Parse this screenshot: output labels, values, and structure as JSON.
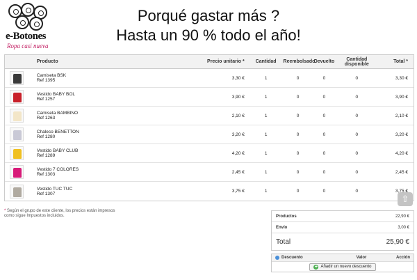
{
  "header": {
    "brand": "e-Botones",
    "tagline": "Ropa casi nueva",
    "promo_line1": "Porqué gastar más ?",
    "promo_line2": "Hasta un 90 % todo el año!"
  },
  "cart": {
    "columns": {
      "product": "Producto",
      "unit_price": "Precio unitario *",
      "quantity": "Cantidad",
      "refunded": "Reembolsado",
      "returned": "Devuelto",
      "available": "Cantidad disponible",
      "total": "Total *"
    },
    "rows": [
      {
        "name": "Camiseta BSK",
        "ref": "Ref 1395",
        "price": "3,30 €",
        "qty": "1",
        "refunded": "0",
        "returned": "0",
        "available": "0",
        "total": "3,30 €",
        "thumb_color": "#3a3a3a"
      },
      {
        "name": "Vestido BABY BOL",
        "ref": "Ref 1257",
        "price": "3,90 €",
        "qty": "1",
        "refunded": "0",
        "returned": "0",
        "available": "0",
        "total": "3,90 €",
        "thumb_color": "#c8202a"
      },
      {
        "name": "Camiseta BAMBINO",
        "ref": "Ref 1263",
        "price": "2,10 €",
        "qty": "1",
        "refunded": "0",
        "returned": "0",
        "available": "0",
        "total": "2,10 €",
        "thumb_color": "#f3e6c8"
      },
      {
        "name": "Chaleco BENETTON",
        "ref": "Ref 1280",
        "price": "3,20 €",
        "qty": "1",
        "refunded": "0",
        "returned": "0",
        "available": "0",
        "total": "3,20 €",
        "thumb_color": "#c9c9d6"
      },
      {
        "name": "Vestido BABY CLUB",
        "ref": "Ref 1289",
        "price": "4,20 €",
        "qty": "1",
        "refunded": "0",
        "returned": "0",
        "available": "0",
        "total": "4,20 €",
        "thumb_color": "#f0c020"
      },
      {
        "name": "Vestido 7 COLORES",
        "ref": "Ref 1303",
        "price": "2,45 €",
        "qty": "1",
        "refunded": "0",
        "returned": "0",
        "available": "0",
        "total": "2,45 €",
        "thumb_color": "#d81b79"
      },
      {
        "name": "Vestido TUC TUC",
        "ref": "Ref 1307",
        "price": "3,75 €",
        "qty": "1",
        "refunded": "0",
        "returned": "0",
        "available": "0",
        "total": "3,75 €",
        "thumb_color": "#b0aaa0"
      }
    ]
  },
  "note": {
    "star": "*",
    "text": "Según el grupo de este cliente, los precios están impresos como sigue Impuestos incluidos."
  },
  "totals": {
    "products_label": "Productos",
    "products_value": "22,90 €",
    "shipping_label": "Envío",
    "shipping_value": "3,00 €",
    "total_label": "Total",
    "total_value": "25,90 €"
  },
  "discount": {
    "col_discount": "Descuento",
    "col_value": "Valor",
    "col_action": "Acción",
    "add_label": "Añadir un nuevo descuento"
  },
  "to_top_glyph": "⇧",
  "colors": {
    "brand_pink": "#c0175d",
    "header_bg": "#f2f2f2",
    "border": "#cccccc"
  }
}
